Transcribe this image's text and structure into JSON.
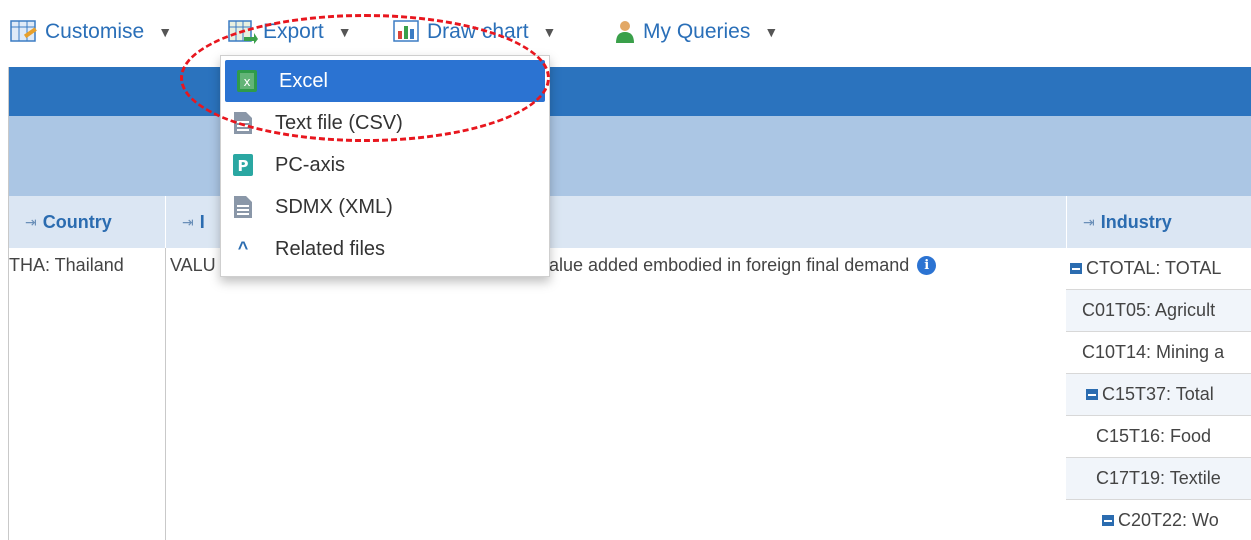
{
  "toolbar": {
    "items": [
      {
        "label": "Customise",
        "icon": "customise-icon"
      },
      {
        "label": "Export",
        "icon": "export-icon"
      },
      {
        "label": "Draw chart",
        "icon": "chart-icon"
      },
      {
        "label": "My Queries",
        "icon": "user-icon"
      }
    ],
    "caret": "▼"
  },
  "export_menu": {
    "items": [
      {
        "label": "Excel",
        "icon": "excel-icon",
        "active": true
      },
      {
        "label": "Text file (CSV)",
        "icon": "csv-file-icon"
      },
      {
        "label": "PC-axis",
        "icon": "pc-axis-icon",
        "glyph": "P"
      },
      {
        "label": "SDMX (XML)",
        "icon": "sdmx-file-icon"
      },
      {
        "label": "Related files",
        "icon": "chevron-up-icon",
        "glyph": "^"
      }
    ]
  },
  "columns": {
    "arrow": "⇥",
    "country": "Country",
    "indicator_partial": "I",
    "industry": "Industry"
  },
  "row": {
    "country": "THA: Thailand",
    "indicator_left": "VALU",
    "indicator_right": "alue added embodied in foreign final demand",
    "info_glyph": "i"
  },
  "industries": [
    {
      "label": "CTOTAL: TOTAL",
      "collapsible": true
    },
    {
      "label": "C01T05: Agricult",
      "collapsible": false
    },
    {
      "label": "C10T14: Mining a",
      "collapsible": false
    },
    {
      "label": "C15T37: Total",
      "collapsible": true
    },
    {
      "label": "C15T16: Food",
      "collapsible": false
    },
    {
      "label": "C17T19: Textile",
      "collapsible": false
    },
    {
      "label": "C20T22: Wo",
      "collapsible": true
    }
  ],
  "colors": {
    "accent": "#2b73d2",
    "header_dark": "#2b73be",
    "header_light": "#abc6e4",
    "highlight": "#e8161e"
  }
}
